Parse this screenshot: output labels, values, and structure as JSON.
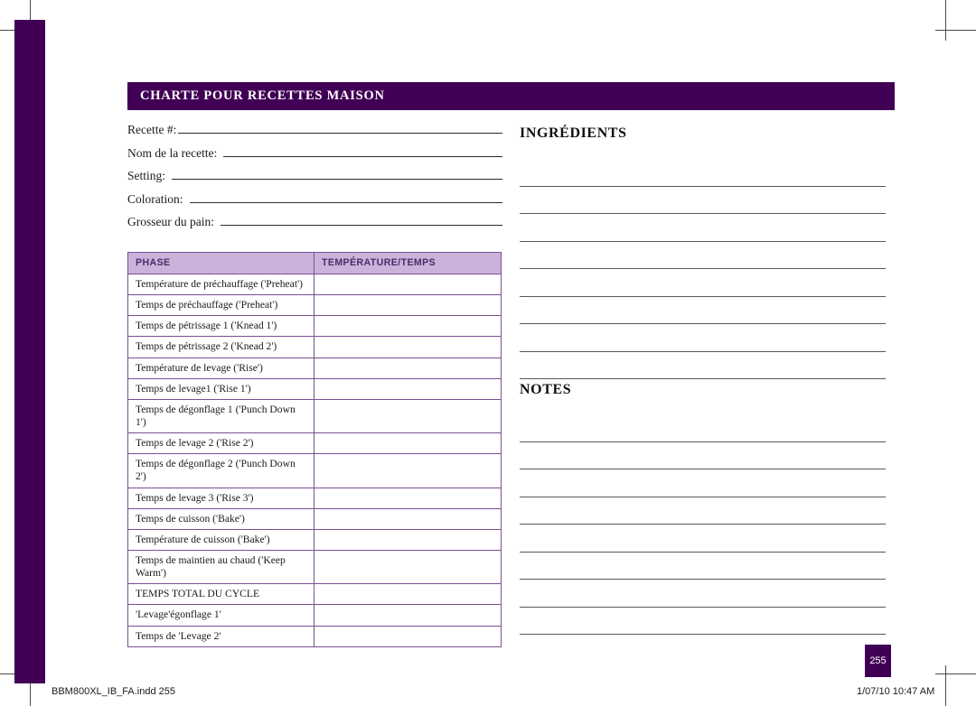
{
  "header": {
    "title": "CHARTE POUR RECETTES MAISON"
  },
  "form_fields": [
    {
      "label": "Recette #:"
    },
    {
      "label": "Nom de la recette:"
    },
    {
      "label": "Setting:"
    },
    {
      "label": "Coloration:"
    },
    {
      "label": "Grosseur du pain:"
    }
  ],
  "phase_table": {
    "columns": [
      "PHASE",
      "TEMPÉRATURE/TEMPS"
    ],
    "rows": [
      {
        "phase": "Température de préchauffage ('Preheat')",
        "value": "",
        "tall": true
      },
      {
        "phase": "Temps de préchauffage ('Preheat')",
        "value": "",
        "tall": false
      },
      {
        "phase": "Temps de pétrissage 1 ('Knead 1')",
        "value": "",
        "tall": false
      },
      {
        "phase": "Temps de pétrissage 2 ('Knead 2')",
        "value": "",
        "tall": false
      },
      {
        "phase": "Température de levage  ('Rise')",
        "value": "",
        "tall": false
      },
      {
        "phase": "Temps de levage1 ('Rise 1')",
        "value": "",
        "tall": false
      },
      {
        "phase": "Temps de dégonflage 1 ('Punch Down 1')",
        "value": "",
        "tall": false
      },
      {
        "phase": "Temps de levage 2 ('Rise 2')",
        "value": "",
        "tall": false
      },
      {
        "phase": "Temps de dégonflage 2 ('Punch Down 2')",
        "value": "",
        "tall": false
      },
      {
        "phase": "Temps de levage 3 ('Rise 3')",
        "value": "",
        "tall": false
      },
      {
        "phase": "Temps de cuisson ('Bake')",
        "value": "",
        "tall": false
      },
      {
        "phase": "Température de cuisson ('Bake')",
        "value": "",
        "tall": false
      },
      {
        "phase": "Temps de maintien au chaud ('Keep Warm')",
        "value": "",
        "tall": true
      },
      {
        "phase": "TEMPS TOTAL DU CYCLE",
        "value": "",
        "tall": false
      },
      {
        "phase": "'Levage'égonflage 1'",
        "value": "",
        "tall": false
      },
      {
        "phase": "Temps de 'Levage 2'",
        "value": "",
        "tall": false
      }
    ]
  },
  "ingredients": {
    "heading": "INGRÉDIENTS",
    "line_count": 8
  },
  "notes": {
    "heading": "NOTES",
    "line_count": 8
  },
  "page_badge": {
    "number": "255"
  },
  "footer": {
    "filename": "BBM800XL_IB_FA.indd   255",
    "timestamp": "1/07/10   10:47 AM"
  },
  "colors": {
    "deep_purple": "#410055",
    "table_header_fill": "#c9b3da",
    "table_header_text": "#4c2a6b",
    "table_border": "#7b4f94",
    "rule_line": "#585858"
  }
}
